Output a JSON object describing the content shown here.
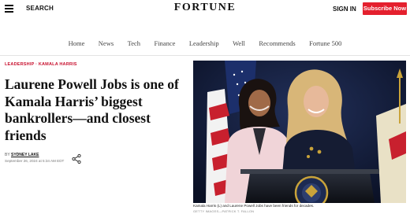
{
  "header": {
    "search_label": "SEARCH",
    "logo": "FORTUNE",
    "signin_label": "SIGN IN",
    "subscribe_label": "Subscribe Now"
  },
  "nav": {
    "items": [
      "Home",
      "News",
      "Tech",
      "Finance",
      "Leadership",
      "Well",
      "Recommends",
      "Fortune 500"
    ]
  },
  "article": {
    "eyebrow": "LEADERSHIP · KAMALA HARRIS",
    "headline": "Laurene Powell Jobs is one of Kamala Harris’ biggest bankrollers—and closest friends",
    "by_label": "BY",
    "author": "SYDNEY LAKE",
    "date": "September 26, 2024 at 5:34 AM EDT",
    "share_icon": "share-icon"
  },
  "photo": {
    "caption": "Kamala Harris (L) and Laurene Powell Jobs have been friends for decades.",
    "credit": "GETTY IMAGES—PATRICK T. FALLON"
  },
  "colors": {
    "brand_red": "#e4202e",
    "eyebrow_red": "#c8102e"
  }
}
